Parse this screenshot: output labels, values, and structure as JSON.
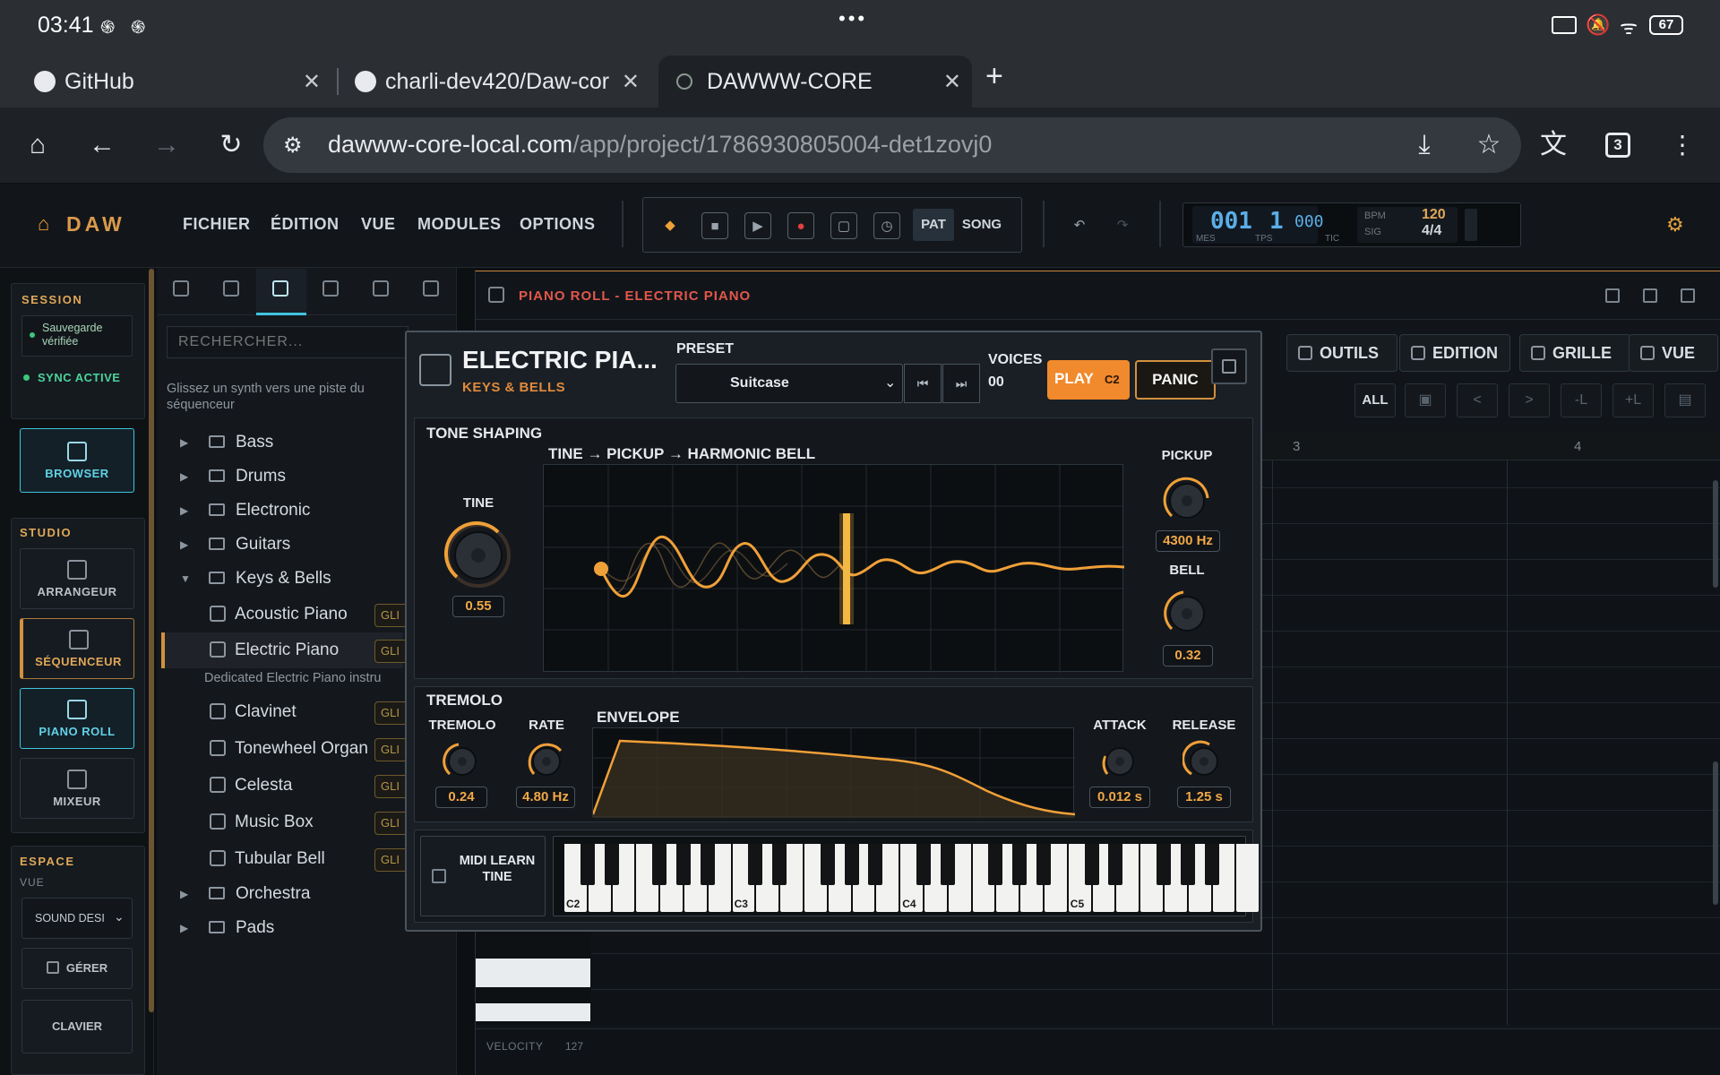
{
  "status": {
    "time": "03:41",
    "battery": "67"
  },
  "tabs": [
    {
      "label": "GitHub"
    },
    {
      "label": "charli-dev420/Daw-core"
    },
    {
      "label": "DAWWW-CORE"
    }
  ],
  "tab_count": "3",
  "url": {
    "domain": "dawww-core-local.com",
    "path": "/app/project/1786930805004-det1zovj0"
  },
  "app": {
    "logo": "DAW",
    "menu": [
      "FICHIER",
      "ÉDITION",
      "VUE",
      "MODULES",
      "OPTIONS"
    ],
    "transport": {
      "pat": "PAT",
      "song": "SONG"
    },
    "position": {
      "bar": "001",
      "beat": "1",
      "tick": "000",
      "mes": "MES",
      "tps": "TPS",
      "tic": "TIC"
    },
    "bpm_label": "BPM",
    "bpm": "120",
    "sig_label": "SIG",
    "sig": "4/4"
  },
  "rail": {
    "session_title": "SESSION",
    "saved": "Sauvegarde vérifiée",
    "sync": "SYNC ACTIVE",
    "browser": "BROWSER",
    "studio_title": "STUDIO",
    "arranger": "ARRANGEUR",
    "sequencer": "SÉQUENCEUR",
    "pianoroll": "PIANO ROLL",
    "mixer": "MIXEUR",
    "space_title": "ESPACE",
    "view_label": "VUE",
    "view_value": "SOUND DESI",
    "manage": "GÉRER",
    "keyboard": "CLAVIER"
  },
  "browser": {
    "search_placeholder": "RECHERCHER...",
    "hint": "Glissez un synth vers une piste du séquenceur",
    "folders": [
      "Bass",
      "Drums",
      "Electronic",
      "Guitars",
      "Keys & Bells"
    ],
    "items": [
      "Acoustic Piano",
      "Electric Piano"
    ],
    "selected_desc": "Dedicated Electric Piano instru",
    "items2": [
      "Clavinet",
      "Tonewheel Organ",
      "Celesta",
      "Music Box",
      "Tubular Bell"
    ],
    "badge": "GLI",
    "folders2": [
      "Orchestra",
      "Pads"
    ]
  },
  "pianoroll": {
    "title": "PIANO ROLL - ELECTRIC PIANO",
    "buttons": [
      "OUTILS",
      "EDITION",
      "GRILLE",
      "VUE"
    ],
    "all": "ALL",
    "small": [
      "<",
      ">",
      "-L",
      "+L"
    ],
    "bar3": "3",
    "bar4": "4",
    "velocity_label": "VELOCITY",
    "velocity_value": "127"
  },
  "synth": {
    "name": "ELECTRIC PIA...",
    "category": "KEYS & BELLS",
    "preset_label": "PRESET",
    "preset_value": "Suitcase",
    "voices_label": "VOICES",
    "voices_value": "00",
    "play": "PLAY",
    "play_note": "C2",
    "panic": "PANIC",
    "tone_title": "TONE SHAPING",
    "chain": "TINE → PICKUP → HARMONIC BELL",
    "tine_label": "TINE",
    "tine_value": "0.55",
    "pickup_label": "PICKUP",
    "pickup_value": "4300 Hz",
    "bell_label": "BELL",
    "bell_value": "0.32",
    "tremolo_title": "TREMOLO",
    "tremolo_label": "TREMOLO",
    "tremolo_value": "0.24",
    "rate_label": "RATE",
    "rate_value": "4.80 Hz",
    "envelope_label": "ENVELOPE",
    "attack_label": "ATTACK",
    "attack_value": "0.012 s",
    "release_label": "RELEASE",
    "release_value": "1.25 s",
    "midi_learn": "MIDI LEARN TINE",
    "octaves": [
      "C2",
      "C3",
      "C4",
      "C5"
    ]
  },
  "colors": {
    "accent": "#f0a038",
    "cyan": "#3fc4de",
    "bg": "#0d1013"
  }
}
